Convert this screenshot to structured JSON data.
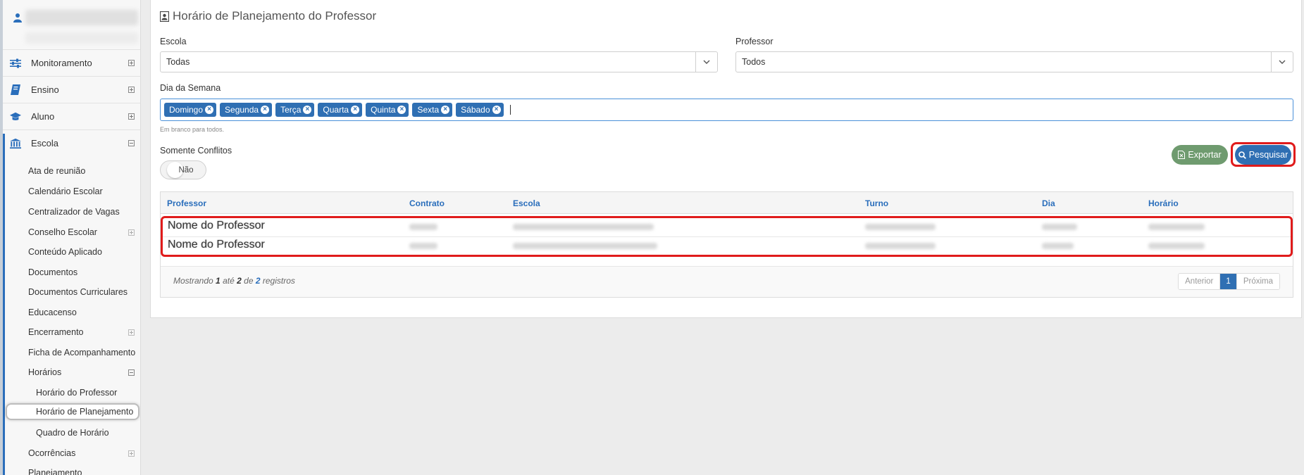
{
  "sidebar": {
    "menu": [
      {
        "label": "Monitoramento",
        "icon": "sliders-icon",
        "expanded": false
      },
      {
        "label": "Ensino",
        "icon": "book-icon",
        "expanded": false
      },
      {
        "label": "Aluno",
        "icon": "graduation-cap-icon",
        "expanded": false
      },
      {
        "label": "Escola",
        "icon": "bank-icon",
        "expanded": true
      }
    ],
    "escola_items": [
      "Ata de reunião",
      "Calendário Escolar",
      "Centralizador de Vagas",
      "Conselho Escolar",
      "Conteúdo Aplicado",
      "Documentos",
      "Documentos Curriculares",
      "Educacenso",
      "Encerramento",
      "Ficha de Acompanhamento",
      "Horários",
      "Horário do Professor",
      "Horário de Planejamento",
      "Quadro de Horário",
      "Ocorrências",
      "Planejamento"
    ]
  },
  "page": {
    "title": "Horário de Planejamento do Professor",
    "escola_label": "Escola",
    "escola_value": "Todas",
    "professor_label": "Professor",
    "professor_value": "Todos",
    "dia_label": "Dia da Semana",
    "dias": [
      "Domingo",
      "Segunda",
      "Terça",
      "Quarta",
      "Quinta",
      "Sexta",
      "Sábado"
    ],
    "hint": "Em branco para todos.",
    "conflitos_label": "Somente Conflitos",
    "conflitos_value": "Não",
    "export_label": "Exportar",
    "search_label": "Pesquisar"
  },
  "table": {
    "columns": [
      "Professor",
      "Contrato",
      "Escola",
      "Turno",
      "Dia",
      "Horário"
    ],
    "rows": [
      {
        "professor": "Nome do Professor"
      },
      {
        "professor": "Nome do Professor"
      }
    ],
    "footer": {
      "prefix": "Mostrando",
      "from": "1",
      "mid1": "até",
      "to": "2",
      "mid2": "de",
      "total": "2",
      "suffix": "registros"
    },
    "pager": {
      "prev": "Anterior",
      "current": "1",
      "next": "Próxima"
    }
  },
  "colors": {
    "accent": "#2f6fb3",
    "export": "#6f9b6f",
    "highlight": "#e01b1b"
  }
}
